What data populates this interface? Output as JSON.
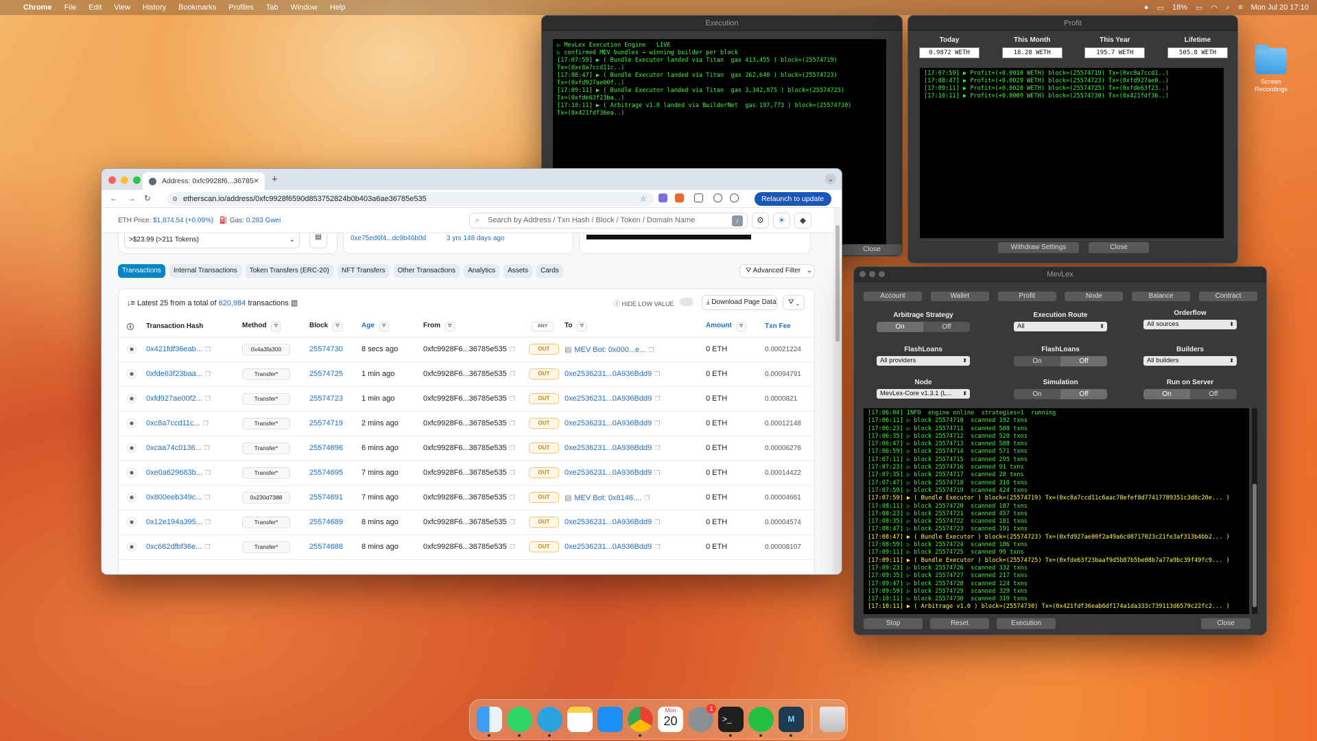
{
  "menubar": {
    "app": "Chrome",
    "items": [
      "File",
      "Edit",
      "View",
      "History",
      "Bookmarks",
      "Profiles",
      "Tab",
      "Window",
      "Help"
    ],
    "battery": "18%",
    "datetime": "Mon Jul 20  17:10"
  },
  "desktop": {
    "folder_label": "Screen Recordings"
  },
  "execution_window": {
    "title": "Execution",
    "lines": [
      "▷ MevLex Execution Engine   LIVE",
      "▷ confirmed MEV bundles → winning builder per block",
      "[17:07:59] ▶ ( Bundle Executor landed via Titan  gas 413,455 ) block=(25574719)",
      "Tx=(0xc8a7ccd11c..)",
      "[17:08:47] ▶ ( Bundle Executor landed via Titan  gas 262,640 ) block=(25574723)",
      "Tx=(0xfd927ae00f..)",
      "[17:09:11] ▶ ( Bundle Executor landed via Titan  gas 3,342,975 ) block=(25574725)",
      "Tx=(0xfde63f23ba..)",
      "[17:10:11] ▶ ( Arbitrage v1.0 landed via BuilderNet  gas 197,773 ) block=(25574730)",
      "Tx=(0x421fdf36ea..)"
    ],
    "close_label": "Close"
  },
  "profit_window": {
    "title": "Profit",
    "stats": [
      {
        "label": "Today",
        "value": "0.9872 WETH"
      },
      {
        "label": "This Month",
        "value": "18.28 WETH"
      },
      {
        "label": "This Year",
        "value": "195.7 WETH"
      },
      {
        "label": "Lifetime",
        "value": "505.8 WETH"
      }
    ],
    "lines": [
      "[17:07:59] ▶ Profit=(+0.0018 WETH) block=(25574719) Tx=(0xc8a7ccd1..)",
      "[17:08:47] ▶ Profit=(+0.0029 WETH) block=(25574723) Tx=(0xfd927ae0..)",
      "[17:09:11] ▶ Profit=(+0.0020 WETH) block=(25574725) Tx=(0xfde63f23..)",
      "[17:10:11] ▶ Profit=(+0.0009 WETH) block=(25574730) Tx=(0x421fdf36..)"
    ],
    "withdraw_label": "Withdraw Settings",
    "close_label": "Close"
  },
  "browser": {
    "tab_title": "Address: 0xfc9928f6...36785",
    "url": "etherscan.io/address/0xfc9928f6590d853752824b0b403a6ae36785e535",
    "relaunch_label": "Relaunch to update",
    "eth_price_label": "ETH Price:",
    "eth_price": "$1,874.54 (+0.09%)",
    "gas_label": "Gas:",
    "gas": "0.283 Gwei",
    "search_placeholder": "Search by Address / Txn Hash / Block / Token / Domain Name",
    "search_key": "/",
    "overview": {
      "token_value": ">$23.99 (>211 Tokens)",
      "funded_by": "0xe75ed6f4...dc9b46b0d",
      "funded_age": "3 yrs 148 days ago"
    },
    "tabs": [
      "Transactions",
      "Internal Transactions",
      "Token Transfers (ERC-20)",
      "NFT Transfers",
      "Other Transactions",
      "Analytics",
      "Assets",
      "Cards"
    ],
    "advanced_filter": "Advanced Filter",
    "summary_prefix": "Latest 25 from a total of",
    "summary_count": "620,984",
    "summary_suffix": "transactions",
    "hide_low_value": "HIDE LOW VALUE",
    "download_label": "Download Page Data",
    "columns": [
      "Transaction Hash",
      "Method",
      "Block",
      "Age",
      "From",
      "ANY",
      "To",
      "Amount",
      "Txn Fee"
    ],
    "rows": [
      {
        "hash": "0x421fdf36eab...",
        "method": "0x4a3fa300",
        "block": "25574730",
        "age": "8 secs ago",
        "from": "0xfc9928F6...36785e535",
        "dir": "OUT",
        "to": "MEV Bot: 0x000...e...",
        "amount": "0 ETH",
        "fee": "0.00021224"
      },
      {
        "hash": "0xfde63f23baa...",
        "method": "Transfer*",
        "block": "25574725",
        "age": "1 min ago",
        "from": "0xfc9928F6...36785e535",
        "dir": "OUT",
        "to": "0xe2536231...0A936Bdd9",
        "amount": "0 ETH",
        "fee": "0.00094791"
      },
      {
        "hash": "0xfd927ae00f2...",
        "method": "Transfer*",
        "block": "25574723",
        "age": "1 min ago",
        "from": "0xfc9928F6...36785e535",
        "dir": "OUT",
        "to": "0xe2536231...0A936Bdd9",
        "amount": "0 ETH",
        "fee": "0.0000821"
      },
      {
        "hash": "0xc8a7ccd11c...",
        "method": "Transfer*",
        "block": "25574719",
        "age": "2 mins ago",
        "from": "0xfc9928F6...36785e535",
        "dir": "OUT",
        "to": "0xe2536231...0A936Bdd9",
        "amount": "0 ETH",
        "fee": "0.00012148"
      },
      {
        "hash": "0xcaa74c0136...",
        "method": "Transfer*",
        "block": "25574696",
        "age": "6 mins ago",
        "from": "0xfc9928F6...36785e535",
        "dir": "OUT",
        "to": "0xe2536231...0A936Bdd9",
        "amount": "0 ETH",
        "fee": "0.00006276"
      },
      {
        "hash": "0xe0a629683b...",
        "method": "Transfer*",
        "block": "25574695",
        "age": "7 mins ago",
        "from": "0xfc9928F6...36785e535",
        "dir": "OUT",
        "to": "0xe2536231...0A936Bdd9",
        "amount": "0 ETH",
        "fee": "0.00014422"
      },
      {
        "hash": "0x800eeb349c...",
        "method": "0x230d7388",
        "block": "25574691",
        "age": "7 mins ago",
        "from": "0xfc9928F6...36785e535",
        "dir": "OUT",
        "to": "MEV Bot: 0x8146....",
        "amount": "0 ETH",
        "fee": "0.00004661"
      },
      {
        "hash": "0x12e194a395...",
        "method": "Transfer*",
        "block": "25574689",
        "age": "8 mins ago",
        "from": "0xfc9928F6...36785e535",
        "dir": "OUT",
        "to": "0xe2536231...0A936Bdd9",
        "amount": "0 ETH",
        "fee": "0.00004574"
      },
      {
        "hash": "0xc662dfbf36e...",
        "method": "Transfer*",
        "block": "25574688",
        "age": "8 mins ago",
        "from": "0xfc9928F6...36785e535",
        "dir": "OUT",
        "to": "0xe2536231...0A936Bdd9",
        "amount": "0 ETH",
        "fee": "0.00008107"
      }
    ]
  },
  "mevlex": {
    "title": "MevLex",
    "tabs": [
      "Account",
      "Wallet",
      "Profit",
      "Node",
      "Balance",
      "Contract"
    ],
    "arbitrage_strategy": {
      "label": "Arbitrage Strategy",
      "on": "On",
      "off": "Off"
    },
    "execution_route": {
      "label": "Execution Route",
      "value": "All"
    },
    "orderflow": {
      "label": "Orderflow",
      "value": "All sources"
    },
    "flashloans_providers": {
      "label": "FlashLoans",
      "value": "All providers"
    },
    "flashloans_toggle": {
      "label": "FlashLoans",
      "on": "On",
      "off": "Off"
    },
    "builders": {
      "label": "Builders",
      "value": "All builders"
    },
    "node": {
      "label": "Node",
      "value": "MevLex-Core v1.3.1 (L..."
    },
    "simulation": {
      "label": "Simulation",
      "on": "On",
      "off": "Off"
    },
    "run_on_server": {
      "label": "Run on Server",
      "on": "On",
      "off": "Off"
    },
    "log": [
      "[17:06:04] INFO  engine online  strategies=1  running",
      "[17:06:11] ▷ block 25574710  scanned 192 txns",
      "[17:06:23] ▷ block 25574711  scanned 588 txns",
      "[17:06:35] ▷ block 25574712  scanned 520 txns",
      "[17:06:47] ▷ block 25574713  scanned 588 txns",
      "[17:06:59] ▷ block 25574714  scanned 571 txns",
      "[17:07:11] ▷ block 25574715  scanned 295 txns",
      "[17:07:23] ▷ block 25574716  scanned 91 txns",
      "[17:07:35] ▷ block 25574717  scanned 28 txns",
      "[17:07:47] ▷ block 25574718  scanned 310 txns",
      "[17:07:59] ▷ block 25574719  scanned 424 txns",
      "[17:07:59] ▶ ( Bundle Executor ) block=(25574719) Tx=(0xc8a7ccd11c6aac78efef8d77417789351c3d8c20e... )",
      "[17:08:11] ▷ block 25574720  scanned 187 txns",
      "[17:08:23] ▷ block 25574721  scanned 457 txns",
      "[17:08:35] ▷ block 25574722  scanned 181 txns",
      "[17:08:47] ▷ block 25574723  scanned 191 txns",
      "[17:08:47] ▶ ( Bundle Executor ) block=(25574723) Tx=(0xfd927ae00f2a49a6c08717023c21fe3af313b4bb2... )",
      "[17:08:59] ▷ block 25574724  scanned 186 txns",
      "[17:09:11] ▷ block 25574725  scanned 99 txns",
      "[17:09:11] ▶ ( Bundle Executor ) block=(25574725) Tx=(0xfde63f23baaf9d5b87b5be08b7a77a9bc39f49fc9... )",
      "[17:09:23] ▷ block 25574726  scanned 332 txns",
      "[17:09:35] ▷ block 25574727  scanned 217 txns",
      "[17:09:47] ▷ block 25574728  scanned 124 txns",
      "[17:09:59] ▷ block 25574729  scanned 329 txns",
      "[17:10:11] ▷ block 25574730  scanned 319 txns",
      "[17:10:11] ▶ ( Arbitrage v1.0 ) block=(25574730) Tx=(0x421fdf36eab6df174a1da333c739113d6579c22fc2... )"
    ],
    "stop_label": "Stop",
    "reset_label": "Reset",
    "execution_label": "Execution",
    "close_label": "Close"
  },
  "dock": {
    "calendar_month": "Mon",
    "calendar_day": "20",
    "badge": "1"
  }
}
